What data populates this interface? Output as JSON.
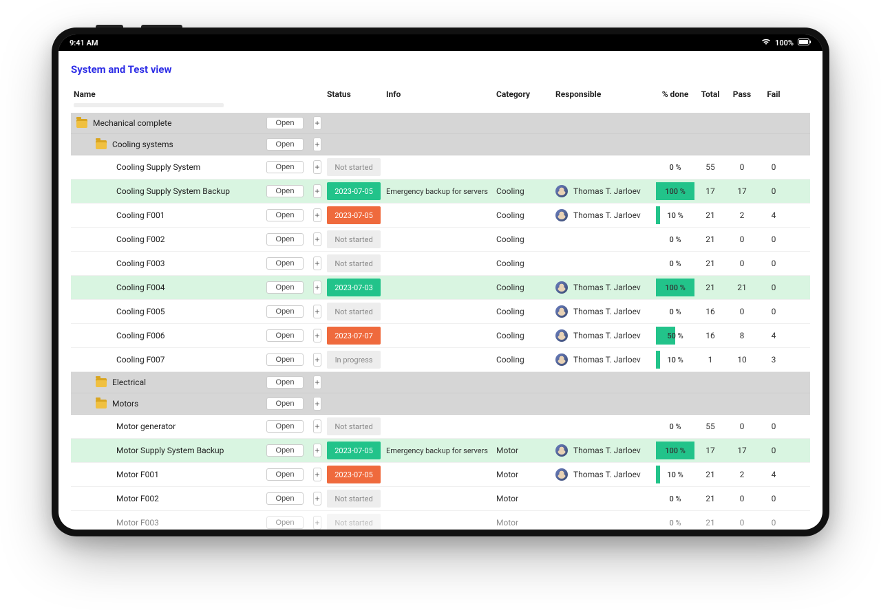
{
  "statusbar": {
    "time": "9:41 AM",
    "battery": "100%"
  },
  "page": {
    "title": "System and Test view"
  },
  "columns": {
    "name": "Name",
    "status": "Status",
    "info": "Info",
    "category": "Category",
    "responsible": "Responsible",
    "done": "% done",
    "total": "Total",
    "pass": "Pass",
    "fail": "Fail"
  },
  "buttons": {
    "open": "Open",
    "plus": "+"
  },
  "folders": [
    {
      "label": "Mechanical complete",
      "indent": 0
    },
    {
      "label": "Cooling systems",
      "indent": 1
    },
    {
      "label": "Electrical",
      "indent": 1
    },
    {
      "label": "Motors",
      "indent": 1
    }
  ],
  "responsibleName": "Thomas T. Jarloev",
  "rows": [
    {
      "type": "folder",
      "folderIndex": 0
    },
    {
      "type": "folder",
      "folderIndex": 1
    },
    {
      "type": "item",
      "name": "Cooling Supply System",
      "status": "Not started",
      "statusKind": "notstarted",
      "info": "",
      "category": "",
      "responsible": false,
      "done": 0,
      "doneText": "0 %",
      "total": 55,
      "pass": 0,
      "fail": 0,
      "highlight": ""
    },
    {
      "type": "item",
      "name": "Cooling Supply System Backup",
      "status": "2023-07-05",
      "statusKind": "green",
      "info": "Emergency backup for servers",
      "category": "Cooling",
      "responsible": true,
      "done": 100,
      "doneText": "100 %",
      "total": 17,
      "pass": 17,
      "fail": 0,
      "highlight": "green"
    },
    {
      "type": "item",
      "name": "Cooling F001",
      "status": "2023-07-05",
      "statusKind": "orange",
      "info": "",
      "category": "Cooling",
      "responsible": true,
      "done": 10,
      "doneText": "10 %",
      "total": 21,
      "pass": 2,
      "fail": 4,
      "highlight": ""
    },
    {
      "type": "item",
      "name": "Cooling F002",
      "status": "Not started",
      "statusKind": "notstarted",
      "info": "",
      "category": "Cooling",
      "responsible": false,
      "done": 0,
      "doneText": "0 %",
      "total": 21,
      "pass": 0,
      "fail": 0,
      "highlight": ""
    },
    {
      "type": "item",
      "name": "Cooling F003",
      "status": "Not started",
      "statusKind": "notstarted",
      "info": "",
      "category": "Cooling",
      "responsible": false,
      "done": 0,
      "doneText": "0 %",
      "total": 21,
      "pass": 0,
      "fail": 0,
      "highlight": ""
    },
    {
      "type": "item",
      "name": "Cooling F004",
      "status": "2023-07-03",
      "statusKind": "green",
      "info": "",
      "category": "Cooling",
      "responsible": true,
      "done": 100,
      "doneText": "100 %",
      "total": 21,
      "pass": 21,
      "fail": 0,
      "highlight": "green"
    },
    {
      "type": "item",
      "name": "Cooling F005",
      "status": "Not started",
      "statusKind": "notstarted",
      "info": "",
      "category": "Cooling",
      "responsible": true,
      "done": 0,
      "doneText": "0 %",
      "total": 16,
      "pass": 0,
      "fail": 0,
      "highlight": ""
    },
    {
      "type": "item",
      "name": "Cooling F006",
      "status": "2023-07-07",
      "statusKind": "orange",
      "info": "",
      "category": "Cooling",
      "responsible": true,
      "done": 50,
      "doneText": "50 %",
      "total": 16,
      "pass": 8,
      "fail": 4,
      "highlight": ""
    },
    {
      "type": "item",
      "name": "Cooling F007",
      "status": "In progress",
      "statusKind": "inprogress",
      "info": "",
      "category": "Cooling",
      "responsible": true,
      "done": 10,
      "doneText": "10 %",
      "total": 1,
      "pass": 10,
      "fail": 3,
      "highlight": ""
    },
    {
      "type": "folder",
      "folderIndex": 2
    },
    {
      "type": "folder",
      "folderIndex": 3
    },
    {
      "type": "item",
      "name": "Motor generator",
      "status": "Not started",
      "statusKind": "notstarted",
      "info": "",
      "category": "",
      "responsible": false,
      "done": 0,
      "doneText": "0 %",
      "total": 55,
      "pass": 0,
      "fail": 0,
      "highlight": ""
    },
    {
      "type": "item",
      "name": "Motor Supply System Backup",
      "status": "2023-07-05",
      "statusKind": "green",
      "info": "Emergency backup for servers",
      "category": "Motor",
      "responsible": true,
      "done": 100,
      "doneText": "100 %",
      "total": 17,
      "pass": 17,
      "fail": 0,
      "highlight": "green"
    },
    {
      "type": "item",
      "name": "Motor F001",
      "status": "2023-07-05",
      "statusKind": "orange",
      "info": "",
      "category": "Motor",
      "responsible": true,
      "done": 10,
      "doneText": "10 %",
      "total": 21,
      "pass": 2,
      "fail": 4,
      "highlight": ""
    },
    {
      "type": "item",
      "name": "Motor F002",
      "status": "Not started",
      "statusKind": "notstarted",
      "info": "",
      "category": "Motor",
      "responsible": false,
      "done": 0,
      "doneText": "0 %",
      "total": 21,
      "pass": 0,
      "fail": 0,
      "highlight": ""
    },
    {
      "type": "item",
      "name": "Motor F003",
      "status": "Not started",
      "statusKind": "notstarted",
      "info": "",
      "category": "Motor",
      "responsible": false,
      "done": 0,
      "doneText": "0 %",
      "total": 21,
      "pass": 0,
      "fail": 0,
      "highlight": "",
      "truncated": true
    }
  ]
}
